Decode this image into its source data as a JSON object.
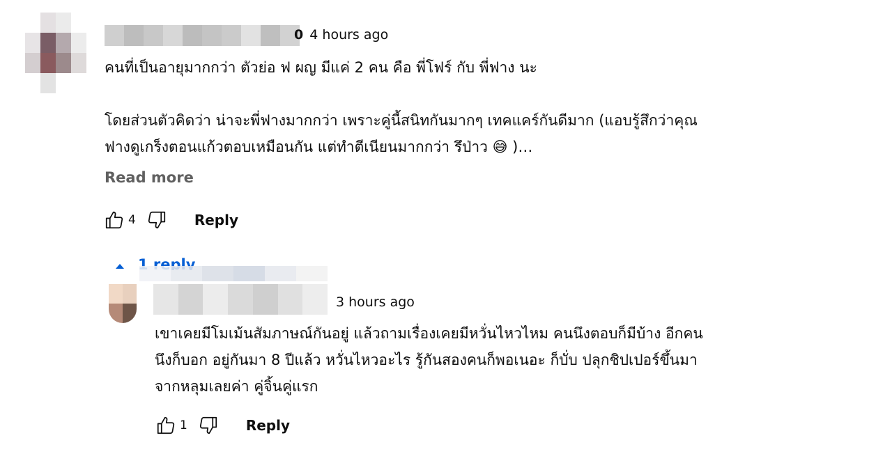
{
  "main_comment": {
    "timestamp": "4 hours ago",
    "username_tail": "0",
    "text_lines": [
      "คนที่เป็นอายุมากกว่า ตัวย่อ ฟ ผญ มีแค่ 2 คน คือ พี่โฟร์ กับ พี่ฟาง นะ",
      "",
      "โดยส่วนตัวคิดว่า น่าจะพี่ฟางมากกว่า เพราะคู่นี้สนิทกันมากๆ เทคแคร์กันดีมาก (แอบรู้สึกว่าคุณ",
      "ฟางดูเกร็งตอนแก้วตอบเหมือนกัน แต่ทำตีเนียนมากกว่า รึป่าว 😅 )…"
    ],
    "read_more_label": "Read more",
    "like_count": "4",
    "reply_label": "Reply",
    "replies_toggle_label": "1 reply"
  },
  "reply_comment": {
    "timestamp": "3 hours ago",
    "text_lines": [
      "เขาเคยมีโมเม้นสัมภาษณ์กันอยู่ แล้วถามเรื่องเคยมีหวั่นไหวไหม คนนึงตอบก็มีบ้าง อีกคน",
      "นึงก็บอก อยู่กันมา 8 ปีแล้ว หวั่นไหวอะไร รู้กันสองคนก็พอเนอะ ก็บั่บ ปลุกชิปเปอร์ขึ้นมา",
      "จากหลุมเลยค่า คู่จิ้นคู่แรก"
    ],
    "like_count": "1",
    "reply_label": "Reply"
  },
  "icons": {
    "like": "thumbs-up-icon",
    "dislike": "thumbs-down-icon",
    "caret": "chevron-up-icon"
  },
  "colors": {
    "text": "#0f0f0f",
    "secondary": "#606060",
    "link": "#065fd4"
  }
}
